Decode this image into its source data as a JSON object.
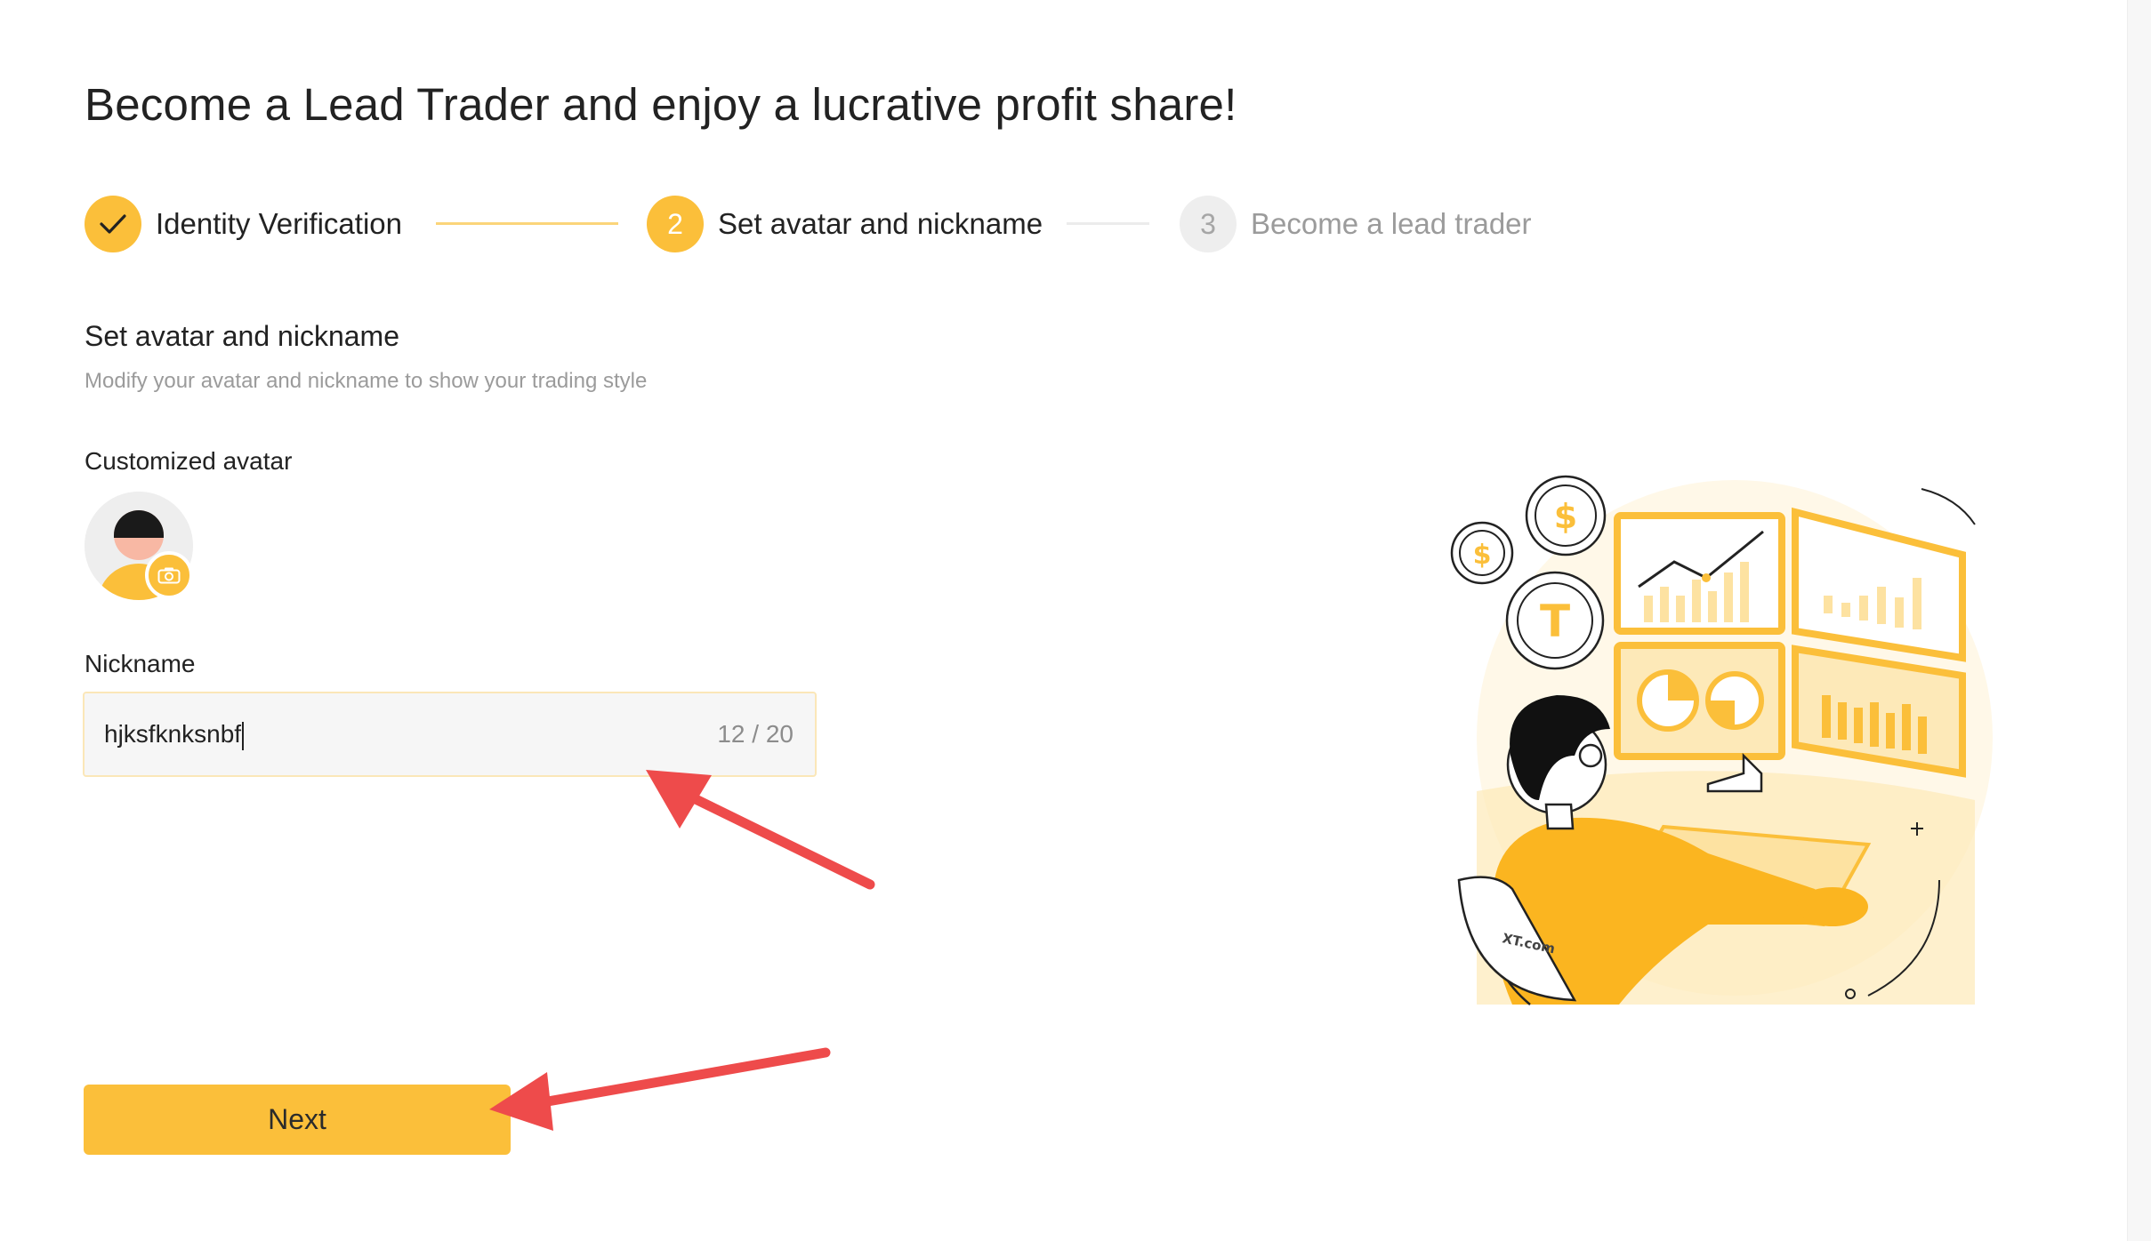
{
  "page": {
    "title": "Become a Lead Trader and enjoy a lucrative profit share!"
  },
  "stepper": {
    "steps": [
      {
        "number": "",
        "label": "Identity Verification",
        "state": "done"
      },
      {
        "number": "2",
        "label": "Set avatar and nickname",
        "state": "active"
      },
      {
        "number": "3",
        "label": "Become a lead trader",
        "state": "pending"
      }
    ]
  },
  "form": {
    "section_title": "Set avatar and nickname",
    "section_subtitle": "Modify your avatar and nickname to show your trading style",
    "avatar_label": "Customized avatar",
    "nickname_label": "Nickname",
    "nickname_value": "hjksfknksnbf",
    "nickname_count": "12 / 20",
    "next_label": "Next"
  },
  "illustration": {
    "brand": "XT.com"
  },
  "colors": {
    "accent": "#fbbf3a",
    "annotation_arrow": "#ee4b4b"
  }
}
